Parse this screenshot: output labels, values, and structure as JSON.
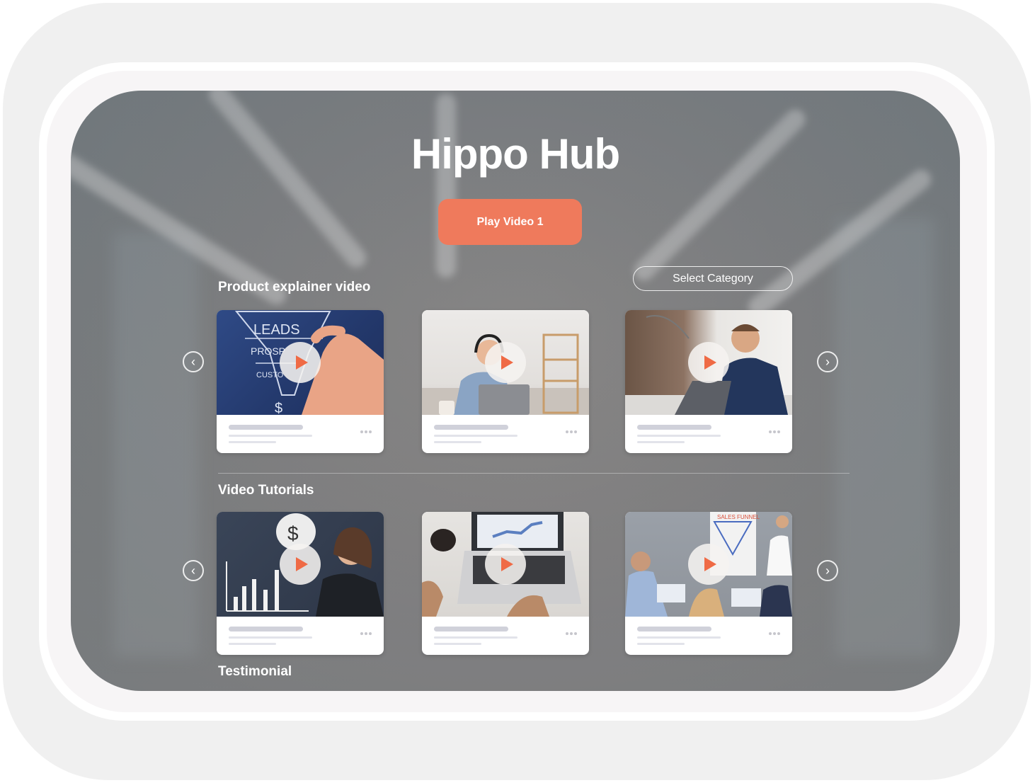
{
  "app": {
    "title": "Hippo Hub",
    "accent_color": "#ef7a5c",
    "play_button_label": "Play Video 1",
    "category_select": {
      "label": "Select Category"
    }
  },
  "sections": [
    {
      "title": "Product explainer video",
      "prev_icon": "chevron-left-circle-icon",
      "next_icon": "chevron-right-circle-icon",
      "cards": [
        {
          "thumbnail": "sales-funnel-leads-prospects-customers",
          "play_icon": "play-icon",
          "menu_icon": "more-horizontal-icon"
        },
        {
          "thumbnail": "man-with-headphones-at-laptop",
          "play_icon": "play-icon",
          "menu_icon": "more-horizontal-icon"
        },
        {
          "thumbnail": "businessman-at-laptop-in-office",
          "play_icon": "play-icon",
          "menu_icon": "more-horizontal-icon"
        }
      ]
    },
    {
      "title": "Video Tutorials",
      "prev_icon": "chevron-left-circle-icon",
      "next_icon": "chevron-right-circle-icon",
      "cards": [
        {
          "thumbnail": "woman-thinking-dollar-growth-chart",
          "play_icon": "play-icon",
          "menu_icon": "more-horizontal-icon"
        },
        {
          "thumbnail": "laptop-with-coffee-on-desk",
          "play_icon": "play-icon",
          "menu_icon": "more-horizontal-icon"
        },
        {
          "thumbnail": "sales-funnel-presentation-meeting",
          "play_icon": "play-icon",
          "menu_icon": "more-horizontal-icon"
        }
      ]
    },
    {
      "title": "Testimonial"
    }
  ]
}
